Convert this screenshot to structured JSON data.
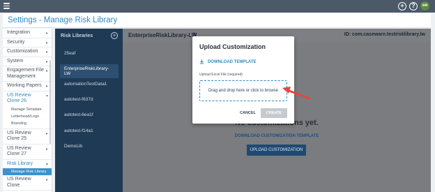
{
  "header": {
    "menu_icon": "hamburger-icon",
    "icons": [
      "add-circle-icon",
      "help-icon"
    ],
    "user_initials": "sw",
    "avatar_color": "#5f8a3d"
  },
  "page": {
    "title": "Settings - Manage Risk Library"
  },
  "nav": {
    "items": [
      {
        "label": "Integration"
      },
      {
        "label": "Security"
      },
      {
        "label": "Customization"
      },
      {
        "label": "System"
      },
      {
        "label": "Engagement File Management"
      },
      {
        "label": "Working Papers"
      },
      {
        "label": "US Review Clone 26"
      },
      {
        "label": "US Review Clone 25"
      },
      {
        "label": "US Review Clone 27"
      },
      {
        "label": "Risk Library"
      },
      {
        "label": "US Review Clone"
      }
    ],
    "clone26_subitems": [
      "Manage Template",
      "Letterhead/Logo",
      "Branding"
    ],
    "risk_subitem": "Manage Risk Library"
  },
  "libraries": {
    "header": "Risk Libraries",
    "items": [
      "25eaf",
      "EnterpriseRiskLibrary-LW",
      "automationTestData1",
      "autotest-f637d",
      "autotest-6ea1f",
      "autotest-f14a1",
      "DemoLib"
    ],
    "selected_index": 1
  },
  "main": {
    "title": "EnterpriseRiskLibrary-LW",
    "id_text": "ID: com.caseware.testrisklibrary.lw",
    "empty_message": "No customizations yet.",
    "download_link": "DOWNLOAD CUSTOMIZATION TEMPLATE",
    "upload_button": "UPLOAD CUSTOMIZATION"
  },
  "modal": {
    "title": "Upload Customization",
    "download_template": "DOWNLOAD TEMPLATE",
    "file_label": "Upload Excel File (required)",
    "dropzone_text": "Drag and drop here or click to browse",
    "cancel": "CANCEL",
    "create": "CREATE"
  },
  "colors": {
    "topbar": "#4b5969",
    "accent": "#2f8bc4",
    "sidebar_dark": "#1f3a55",
    "overlay": "#7a7c7f",
    "arrow": "#e8463f"
  }
}
